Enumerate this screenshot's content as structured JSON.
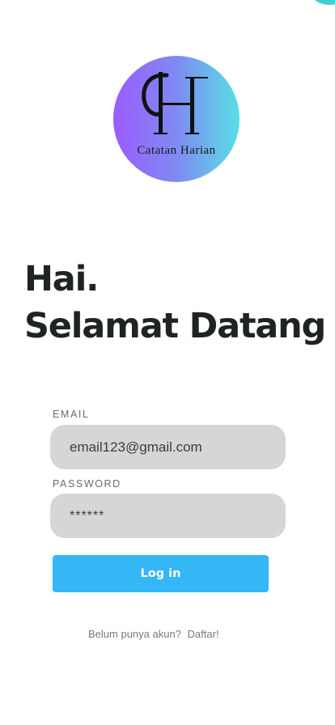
{
  "logo": {
    "monogram": "CH",
    "caption": "Catatan Harian"
  },
  "greeting": {
    "line1": "Hai.",
    "line2": "Selamat Datang"
  },
  "form": {
    "email_label": "EMAIL",
    "email_value": "email123@gmail.com",
    "password_label": "PASSWORD",
    "password_value": "******",
    "login_label": "Log in"
  },
  "footer": {
    "prompt": "Belum punya akun?",
    "signup_link": "Daftar!"
  },
  "colors": {
    "accent": "#35b6f5",
    "logo_gradient_start": "#9b5cff",
    "logo_gradient_end": "#58dfe6",
    "field_background": "#d6d6d6",
    "heading_text": "#202324"
  }
}
